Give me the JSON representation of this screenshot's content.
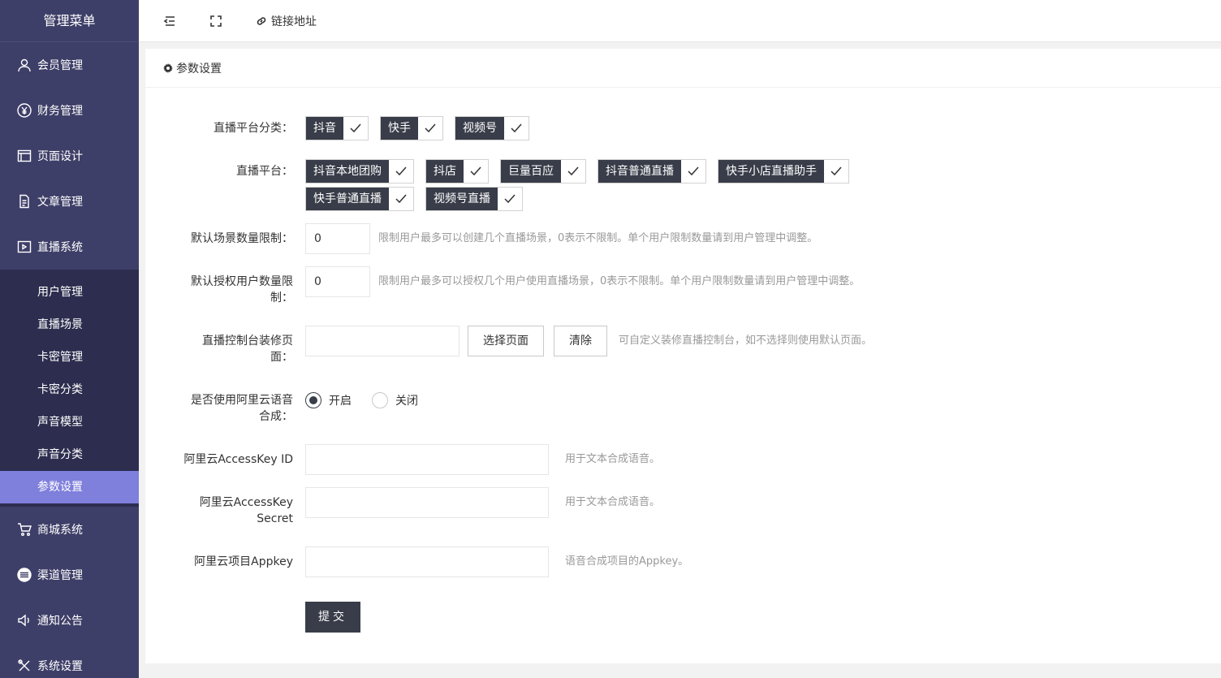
{
  "sidebar": {
    "title": "管理菜单",
    "items_top": [
      {
        "label": "会员管理",
        "icon": "user-icon"
      },
      {
        "label": "财务管理",
        "icon": "yen-icon"
      },
      {
        "label": "页面设计",
        "icon": "layout-icon"
      },
      {
        "label": "文章管理",
        "icon": "document-icon"
      },
      {
        "label": "直播系统",
        "icon": "video-icon"
      }
    ],
    "sub_items": [
      "用户管理",
      "直播场景",
      "卡密管理",
      "卡密分类",
      "声音模型",
      "声音分类",
      "参数设置"
    ],
    "active_sub": "参数设置",
    "items_bottom": [
      {
        "label": "商城系统",
        "icon": "cart-icon"
      },
      {
        "label": "渠道管理",
        "icon": "list-circle-icon"
      },
      {
        "label": "通知公告",
        "icon": "speaker-icon"
      },
      {
        "label": "系统设置",
        "icon": "tools-icon"
      }
    ]
  },
  "topbar": {
    "link_label": "链接地址"
  },
  "panel": {
    "title": "参数设置"
  },
  "form": {
    "platform_category_label": "直播平台分类：",
    "platform_categories": [
      "抖音",
      "快手",
      "视频号"
    ],
    "platform_label": "直播平台：",
    "platforms_row1": [
      "抖音本地团购",
      "抖店",
      "巨量百应",
      "抖音普通直播",
      "快手小店直播助手"
    ],
    "platforms_row2": [
      "快手普通直播",
      "视频号直播"
    ],
    "scene_limit_label": "默认场景数量限制：",
    "scene_limit_value": "0",
    "scene_limit_tip": "限制用户最多可以创建几个直播场景，0表示不限制。单个用户限制数量请到用户管理中调整。",
    "auth_limit_label_1": "默认授权用户数量限",
    "auth_limit_label_2": "制：",
    "auth_limit_value": "0",
    "auth_limit_tip": "限制用户最多可以授权几个用户使用直播场景，0表示不限制。单个用户限制数量请到用户管理中调整。",
    "console_label_1": "直播控制台装修页",
    "console_label_2": "面：",
    "console_value": "",
    "select_page_button": "选择页面",
    "clear_button": "清除",
    "console_tip": "可自定义装修直播控制台，如不选择则使用默认页面。",
    "aliyun_voice_label_1": "是否使用阿里云语音",
    "aliyun_voice_label_2": "合成：",
    "radio_on": "开启",
    "radio_off": "关闭",
    "radio_selected": "开启",
    "ak_id_label": "阿里云AccessKey ID",
    "ak_id_value": "",
    "ak_id_tip": "用于文本合成语音。",
    "ak_secret_label_1": "阿里云AccessKey",
    "ak_secret_label_2": "Secret",
    "ak_secret_value": "",
    "ak_secret_tip": "用于文本合成语音。",
    "appkey_label": "阿里云项目Appkey",
    "appkey_value": "",
    "appkey_tip": "语音合成项目的Appkey。",
    "submit_label": "提交"
  },
  "colors": {
    "sidebar_bg": "#3e3f68",
    "submenu_bg": "#2d2e4f",
    "active_sub_bg": "#7f7fdc",
    "tag_bg": "#393d49",
    "button_dark": "#393d49"
  }
}
